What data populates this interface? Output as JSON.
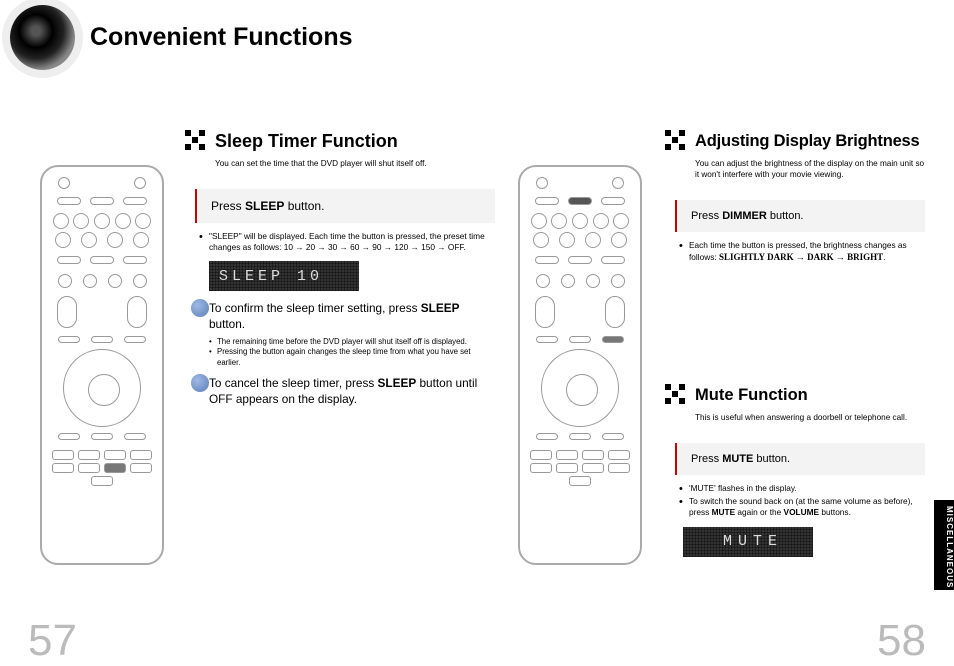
{
  "page_title": "Convenient Functions",
  "side_tab": "MISCELLANEOUS",
  "page_numbers": {
    "left": "57",
    "right": "58"
  },
  "sleep": {
    "heading": "Sleep Timer Function",
    "intro": "You can set the time that the DVD player will shut itself off.",
    "instruction_pre": "Press ",
    "instruction_bold": "SLEEP",
    "instruction_post": " button.",
    "bullet1": "\"SLEEP\" will be displayed. Each time the button is pressed, the preset time changes as follows: 10 → 20 → 30 → 60 → 90 → 120 → 150 → OFF.",
    "display_text": "SLEEP  10",
    "confirm_pre": "To confirm the sleep timer setting, press ",
    "confirm_bold": "SLEEP",
    "confirm_post": " button.",
    "confirm_sub1": "The remaining time before the DVD player will shut itself off is displayed.",
    "confirm_sub2": "Pressing the button again changes the sleep time from what you have set earlier.",
    "cancel_pre": "To cancel the sleep timer, press ",
    "cancel_bold": "SLEEP",
    "cancel_post": " button until OFF appears on the display."
  },
  "brightness": {
    "heading": "Adjusting Display Brightness",
    "intro": "You can adjust the brightness of the display on the main unit so it won't interfere with your movie viewing.",
    "instruction_pre": "Press ",
    "instruction_bold": "DIMMER",
    "instruction_post": " button.",
    "bullet1_pre": "Each time the button is pressed, the brightness changes as follows: ",
    "bullet1_seq": "SLIGHTLY DARK → DARK → BRIGHT"
  },
  "mute": {
    "heading": "Mute Function",
    "intro": "This is useful when answering a doorbell or telephone call.",
    "instruction_pre": "Press ",
    "instruction_bold": "MUTE",
    "instruction_post": " button.",
    "bullet1": "'MUTE' flashes in the display.",
    "bullet2_pre": "To switch the sound back on (at the same volume as before), press ",
    "bullet2_b1": "MUTE",
    "bullet2_mid": " again or the ",
    "bullet2_b2": "VOLUME",
    "bullet2_post": " buttons.",
    "display_text": "MUTE"
  }
}
